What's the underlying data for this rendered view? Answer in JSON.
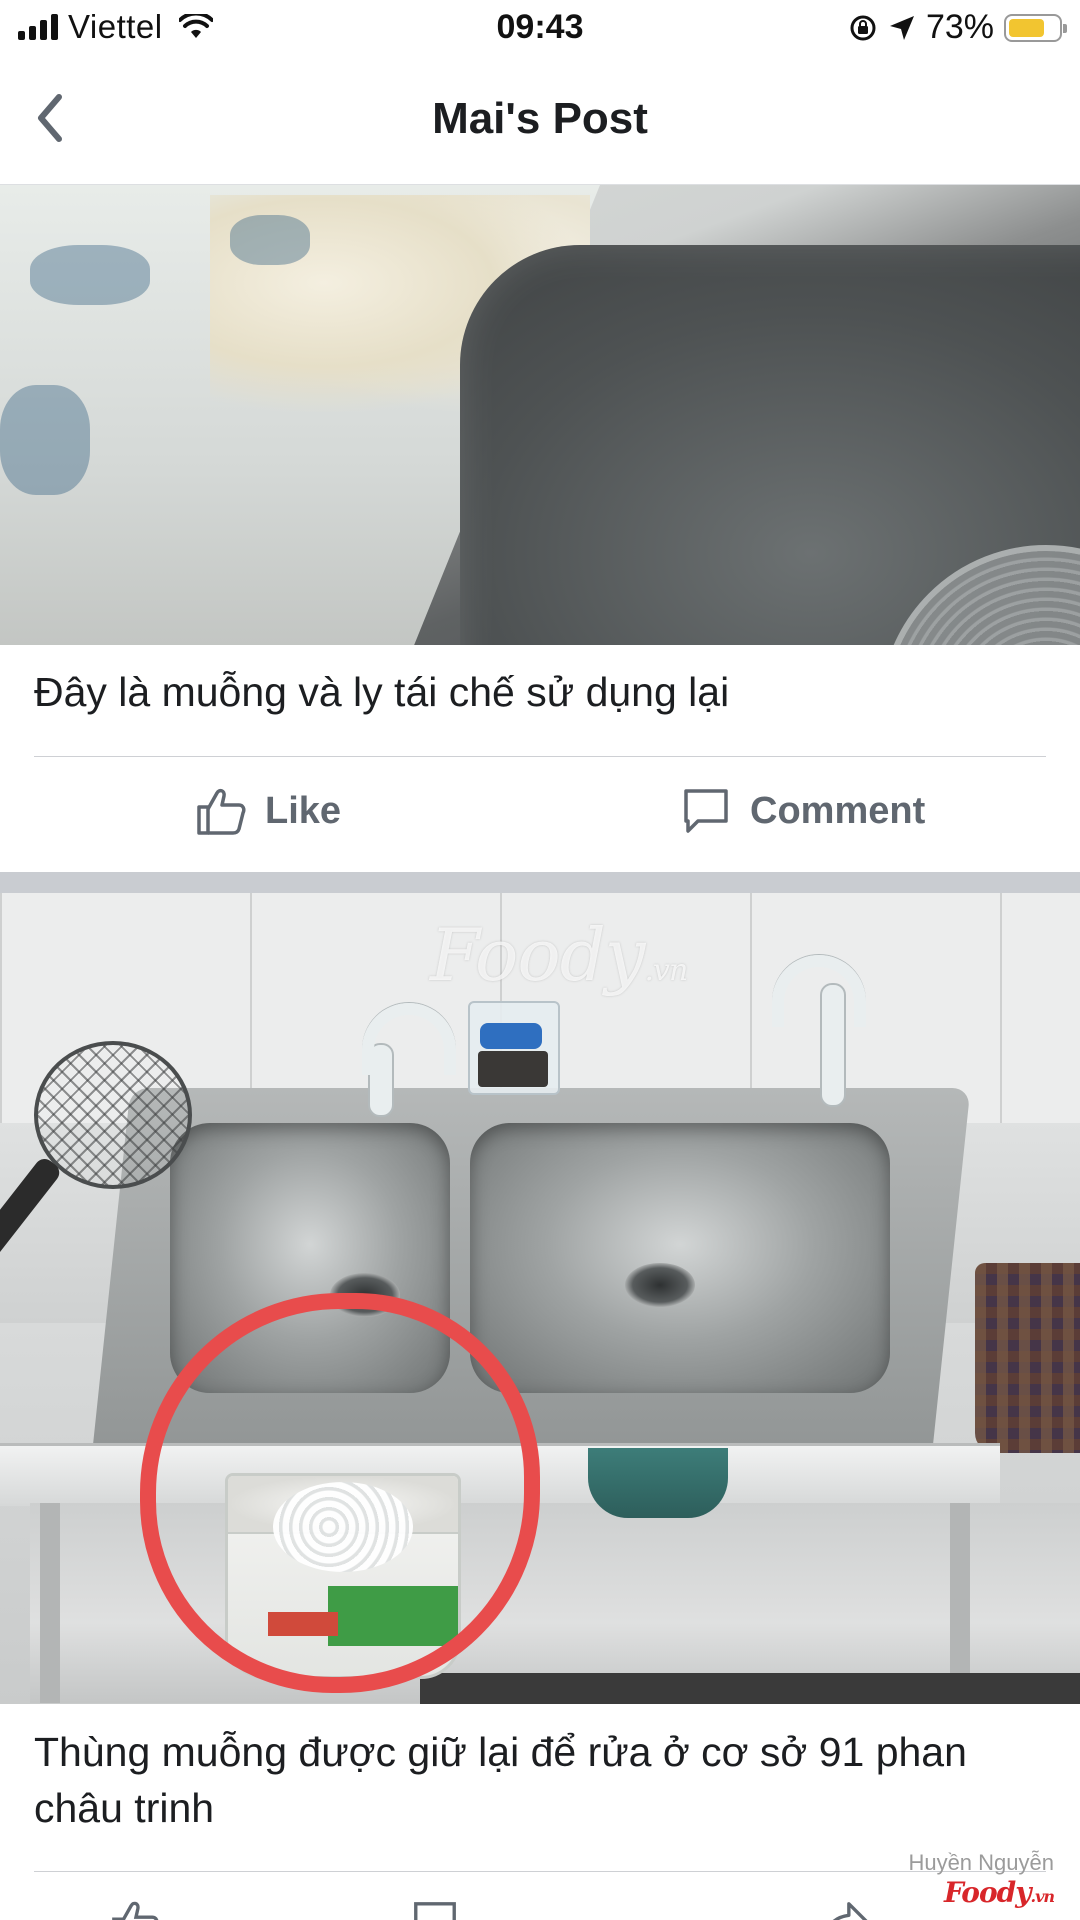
{
  "status_bar": {
    "carrier": "Viettel",
    "time": "09:43",
    "battery_percent": "73%",
    "battery_level": 0.73,
    "icons": [
      "signal-icon",
      "wifi-icon",
      "rotation-lock-icon",
      "location-arrow-icon",
      "battery-icon"
    ]
  },
  "header": {
    "title": "Mai's Post",
    "back_icon": "chevron-left-icon"
  },
  "posts": [
    {
      "caption": "Đây là muỗng và ly tái chế sử dụng lại",
      "actions": {
        "like_label": "Like",
        "comment_label": "Comment"
      }
    },
    {
      "image_watermark": "Foody",
      "image_watermark_suffix": ".vn",
      "caption": "Thùng muỗng được giữ lại để rửa ở cơ sở 91 phan châu trinh"
    }
  ],
  "credit": {
    "name": "Huyền Nguyễn",
    "brand": "Foody",
    "brand_suffix": ".vn"
  },
  "colors": {
    "text_primary": "#1c1e21",
    "action_gray": "#606770",
    "divider": "#ced0d4",
    "annotation_red": "#e84c4c",
    "battery_yellow": "#f2c530"
  }
}
